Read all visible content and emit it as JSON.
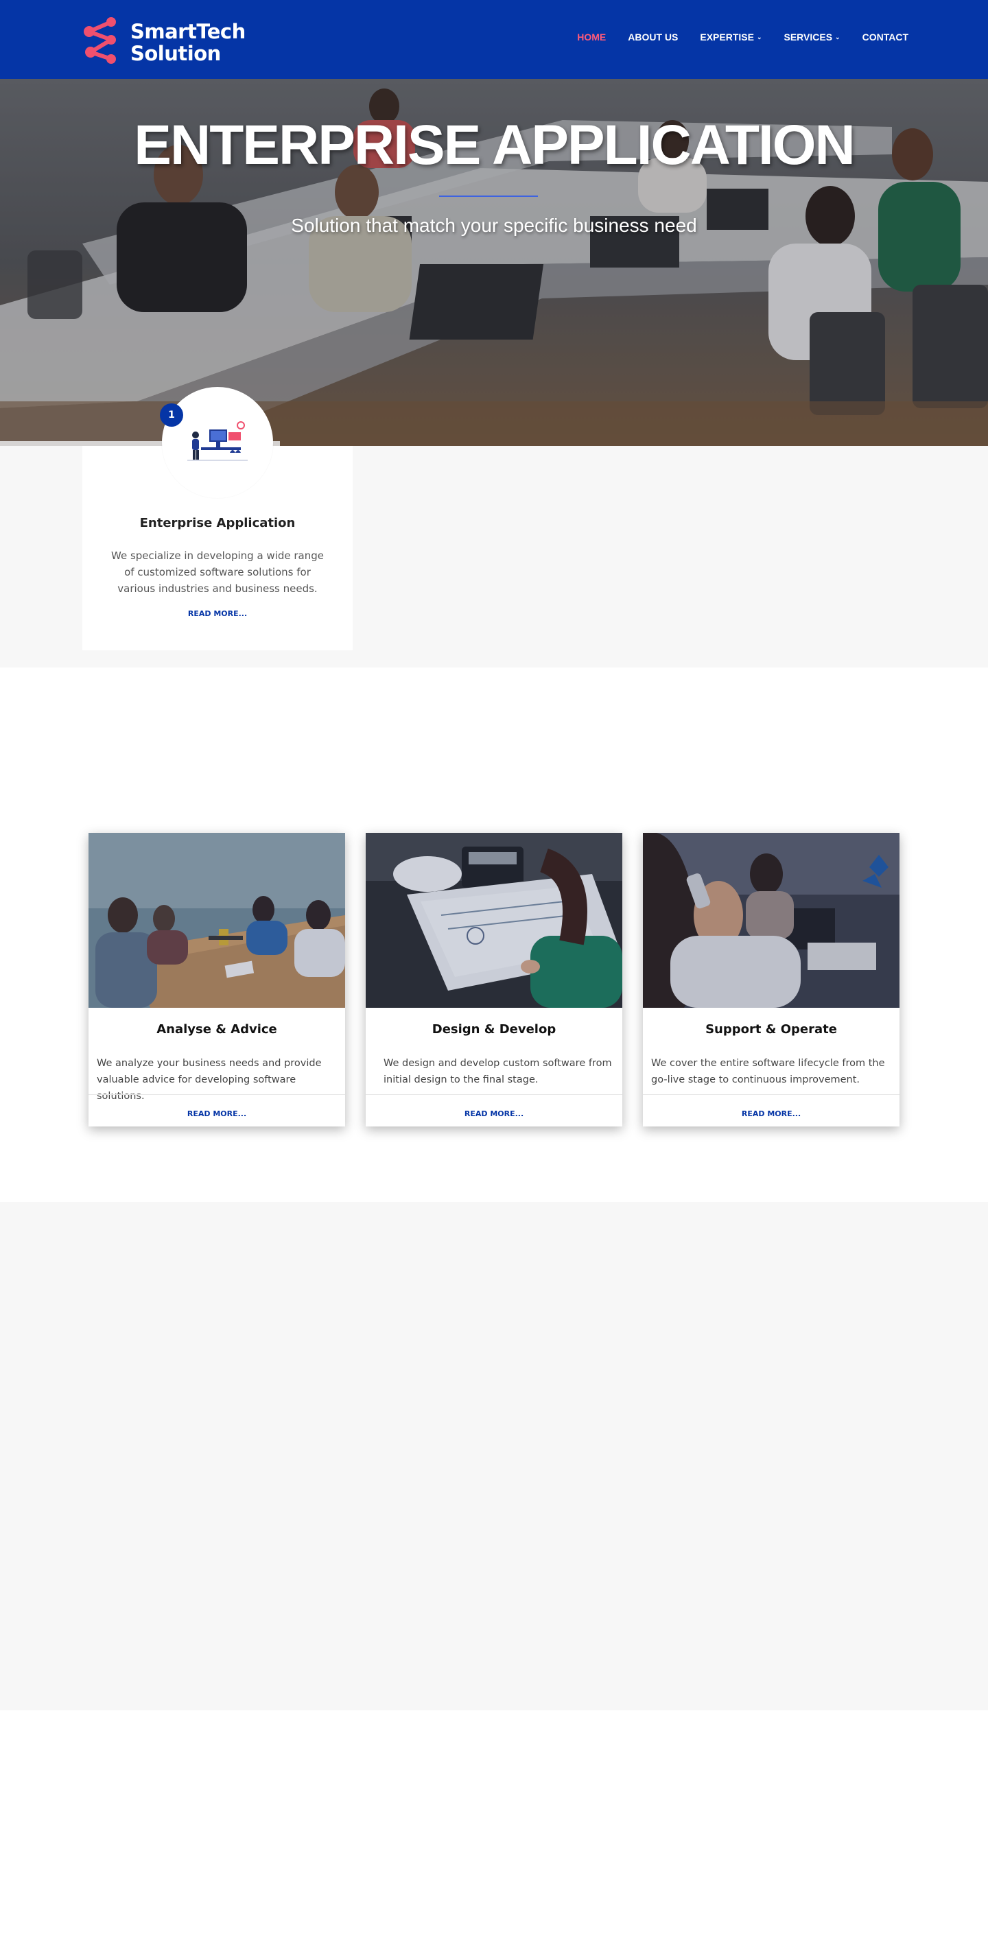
{
  "brand": {
    "line1": "SmartTech",
    "line2": "Solution",
    "logo_color": "#f0506e",
    "header_color": "#0535a6"
  },
  "nav": {
    "items": [
      {
        "label": "HOME",
        "active": true
      },
      {
        "label": "ABOUT US",
        "active": false
      },
      {
        "label": "EXPERTISE",
        "active": false,
        "dropdown": true
      },
      {
        "label": "SERVICES",
        "active": false,
        "dropdown": true
      },
      {
        "label": "CONTACT",
        "active": false
      }
    ],
    "dropdown_glyph": "⌄"
  },
  "hero": {
    "title": "ENTERPRISE APPLICATION",
    "subtitle": "Solution that match your specific business need"
  },
  "feature": {
    "badge": "1",
    "title": "Enterprise Application",
    "description": "We specialize in developing a wide range of customized software solutions for various industries and business needs.",
    "link": "READ MORE..."
  },
  "cards": [
    {
      "title": "Analyse & Advice",
      "description": "We analyze your business needs and provide valuable advice for developing software solutions.",
      "link": "READ MORE..."
    },
    {
      "title": "Design & Develop",
      "description": "We design and develop custom software from initial design to the final stage.",
      "link": "READ MORE..."
    },
    {
      "title": "Support & Operate",
      "description": "We cover the entire software lifecycle from the go-live stage to continuous improvement.",
      "link": "READ MORE..."
    }
  ]
}
